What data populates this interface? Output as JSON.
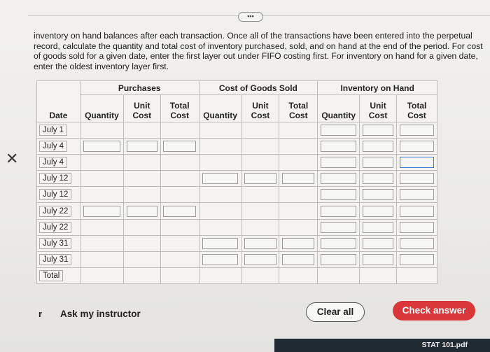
{
  "instructions": "inventory on hand balances after each transaction. Once all of the transactions have been entered into the perpetual record, calculate the quantity and total cost of inventory purchased, sold, and on hand at the end of the period. For cost of goods sold for a given date, enter the first layer out under FIFO costing first. For inventory on hand for a given date, enter the oldest inventory layer first.",
  "more_button": "•••",
  "close_glyph": "✕",
  "table": {
    "groups": {
      "purchases": "Purchases",
      "cogs": "Cost of Goods Sold",
      "on_hand": "Inventory on Hand"
    },
    "headers": {
      "date": "Date",
      "p_qty": "Quantity",
      "p_unit": "Unit Cost",
      "p_total": "Total Cost",
      "c_qty": "Quantity",
      "c_unit": "Unit Cost",
      "c_total": "Total Cost",
      "h_qty": "Quantity",
      "h_unit": "Unit Cost",
      "h_total": "Total Cost"
    },
    "dates": [
      "July 1",
      "July 4",
      "July 4",
      "July 12",
      "July 12",
      "July 22",
      "July 22",
      "July 31",
      "July 31",
      "Total"
    ]
  },
  "ask_marker": "r",
  "ask_instructor": "Ask my instructor",
  "clear_all": "Clear all",
  "check_answer": "Check answer",
  "dock_file": "STAT 101.pdf",
  "colors": {
    "check_button": "#d9373a",
    "focus_border": "#3a7bd5"
  }
}
